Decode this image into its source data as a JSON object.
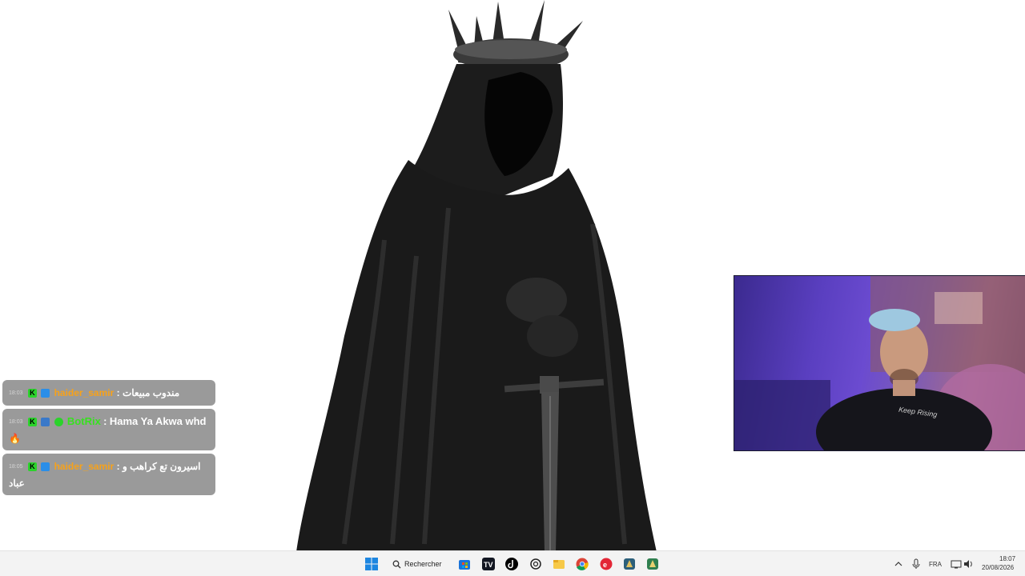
{
  "chat": {
    "messages": [
      {
        "time": "18:03",
        "username": "haider_samir",
        "separator": ":",
        "text": "مندوب مبيعات"
      },
      {
        "time": "18:03",
        "username": "BotRix",
        "separator": ":",
        "text": "Hama Ya Akwa whd",
        "emoji": "🔥"
      },
      {
        "time": "18:05",
        "username": "haider_samir",
        "separator": ":",
        "text": "اسيرون تع كراهب و عباد"
      }
    ]
  },
  "taskbar": {
    "search_label": "Rechercher",
    "language": "FRA",
    "time": "18:07",
    "date": "20/08/2026"
  },
  "webcam": {
    "shirt_text": "Keep Rising"
  }
}
